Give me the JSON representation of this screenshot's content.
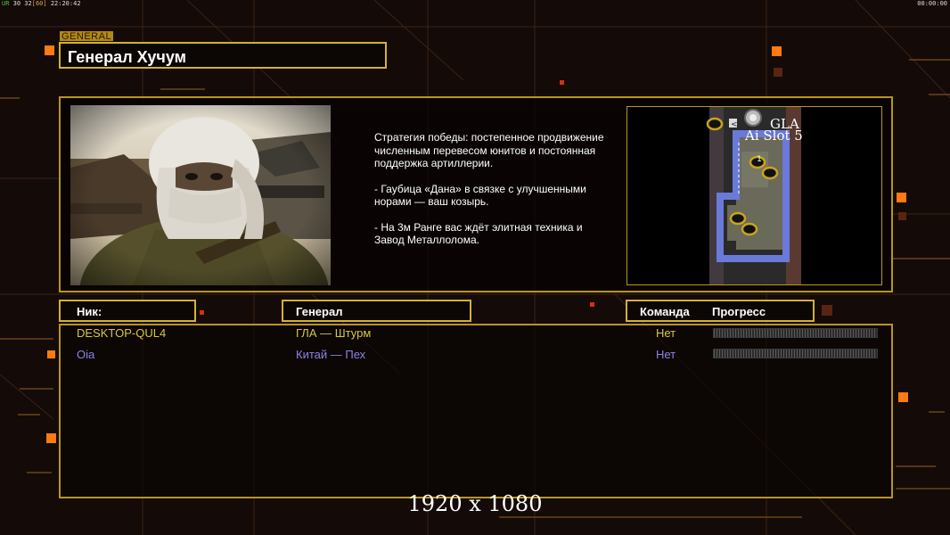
{
  "status_bar": {
    "left_a": "UR",
    "left_b": "30 32",
    "left_c": "[60]",
    "left_d": "22:20:42",
    "right": "00:00:00"
  },
  "general": {
    "tag": "GENERAL",
    "name": "Генерал Хучум"
  },
  "description": [
    "Стратегия победы: постепенное продвижение численным перевесом юнитов и постоянная поддержка артиллерии.",
    "- Гаубица «Дана» в связке с улучшенными норами — ваш козырь.",
    "- На 3м Ранге вас ждёт элитная техника и Завод Металлолома."
  ],
  "minimap": {
    "label_faction": "GLA",
    "label_slot": "Ai Slot 5",
    "marker": "1"
  },
  "table": {
    "headers": {
      "nick": "Ник:",
      "general": "Генерал",
      "team": "Команда",
      "progress": "Прогресс"
    },
    "rows": [
      {
        "nick": "DESKTOP-QUL4",
        "general": "ГЛА — Штурм",
        "team": "Нет",
        "color": "#d6c742",
        "progress": 0
      },
      {
        "nick": "Oia",
        "general": "Китай — Пех",
        "team": "Нет",
        "color": "#8c84e6",
        "progress": 0
      }
    ]
  },
  "resolution_text": "1920 x 1080",
  "colors": {
    "accent": "#d4b22c",
    "background": "#140a08",
    "player1": "#d6c742",
    "player2": "#8c84e6"
  }
}
